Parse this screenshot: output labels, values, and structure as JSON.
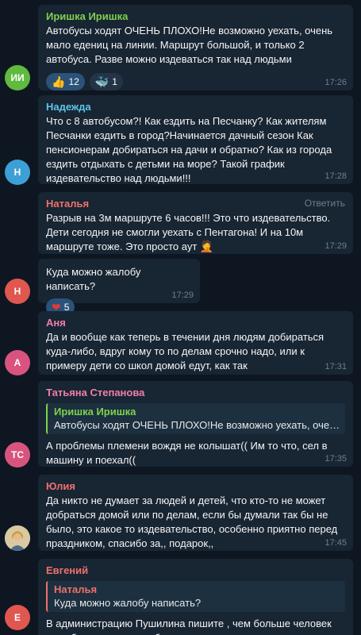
{
  "messages": [
    {
      "sender": "Иришка Иришка",
      "text": "Автобусы ходят ОЧЕНЬ ПЛОХО!Не возможно уехать, очень мало едениц на линии. Маршрут большой, и только 2 автобуса. Разве можно издеваться так над людьми",
      "time": "17:26",
      "avatar": "ИИ",
      "reactions": [
        {
          "icon": "thumbs-up-icon",
          "glyph": "👍",
          "count": "12"
        },
        {
          "icon": "whale-icon",
          "glyph": "🐳",
          "count": "1"
        }
      ]
    },
    {
      "sender": "Надежда",
      "text": "Что с 8 автобусом?! Как ездить на Песчанку?  Как жителям Песчанки ездить в город?Начинается дачный  сезон Как пенсионерам добираться на дачи и обратно?  Как из города ездить отдыхать с детьми на море? Такой график издевательство над людьми!!!",
      "time": "17:28",
      "avatar": "Н"
    },
    {
      "sender": "Наталья",
      "reply_label": "Ответить",
      "text": "Разрыв на 3м маршруте 6 часов!!! Это что издевательство. Дети сегодня не смогли уехать с Пентагона! И на 10м маршруте тоже. Это просто аут",
      "emoji": "🤦",
      "time": "17:29",
      "avatar": "Н"
    },
    {
      "text": "Куда можно жалобу написать?",
      "time": "17:29",
      "reactions": [
        {
          "icon": "heart-icon",
          "glyph": "❤",
          "count": "5"
        }
      ]
    },
    {
      "sender": "Аня",
      "text": "Да и вообще как теперь в течении дня людям добираться куда-либо, вдруг кому то по делам срочно надо, или к примеру дети со школ домой едут, как так",
      "time": "17:31",
      "avatar": "А"
    },
    {
      "sender": "Татьяна Степанова",
      "quote_name": "Иришка Иришка",
      "quote_text": "Автобусы ходят ОЧЕНЬ ПЛОХО!Не возможно уехать, очень мало едениц на линии",
      "text": "А проблемы племени вождя не колышат(( Им то что, сел в машину и поехал((",
      "time": "17:35",
      "avatar": "ТС"
    },
    {
      "sender": "Юлия",
      "text": "Да никто не думает за людей и детей, что кто-то не может добраться домой или по делам, если бы думали так бы не было, это какое то издевательство, особенно приятно перед праздником, спасибо за,, подарок,,",
      "time": "17:45"
    },
    {
      "sender": "Евгений",
      "quote_name": "Наталья",
      "quote_text": "Куда можно жалобу написать?",
      "text": "В администрацию Пушилина пишите , чем больше человек жалобу напишет , тем больше вероятности что что-то решат ,",
      "avatar": "Е"
    }
  ],
  "colors": {
    "background": "#0e1621",
    "bubble": "#182533",
    "name_irishka": "#7fd14b",
    "name_nadezhda": "#5cc5e8",
    "name_natalya": "#f0706b",
    "name_anya": "#f07fa8",
    "name_tatyana": "#f07fa8",
    "name_yulia": "#f0706b",
    "name_evgeny": "#f0706b",
    "avatar_green": "#5fba3e",
    "avatar_blue": "#3d9fd6",
    "avatar_red": "#e0574f",
    "avatar_pink": "#d8547f"
  }
}
